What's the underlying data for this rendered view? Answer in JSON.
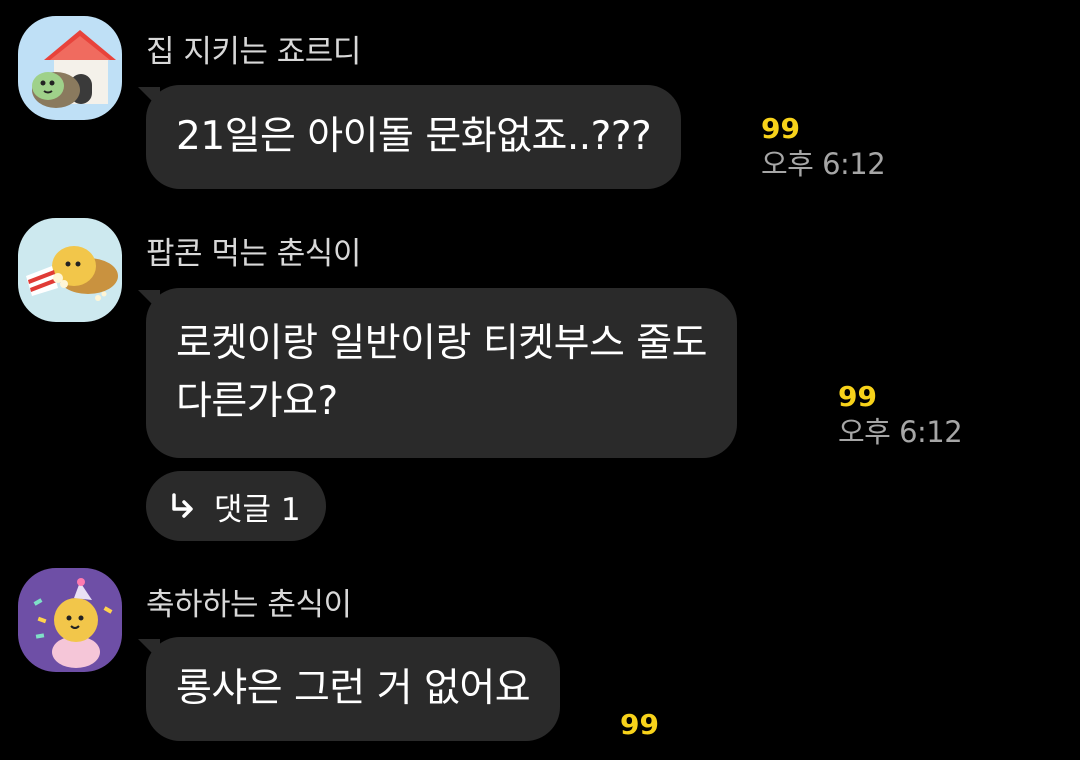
{
  "colors": {
    "background": "#000000",
    "bubble": "#2a2a2a",
    "unread": "#f7d21a",
    "time": "#a6a6a6",
    "sender": "#d8d8d8"
  },
  "messages": [
    {
      "sender": "집 지키는 죠르디",
      "avatar_icon": "jordy-doghouse-avatar",
      "lines": [
        "21일은 아이돌 문화없죠..???"
      ],
      "unread": "99",
      "time": "오후 6:12"
    },
    {
      "sender": "팝콘 먹는 춘식이",
      "avatar_icon": "choonsik-popcorn-avatar",
      "lines": [
        "로켓이랑 일반이랑 티켓부스 줄도",
        "다른가요?"
      ],
      "unread": "99",
      "time": "오후 6:12",
      "reply": {
        "icon": "reply-arrow-icon",
        "label": "댓글 1"
      }
    },
    {
      "sender": "축하하는 춘식이",
      "avatar_icon": "choonsik-party-avatar",
      "lines": [
        "롱샤은 그런 거 없어요"
      ],
      "unread": "99"
    }
  ]
}
